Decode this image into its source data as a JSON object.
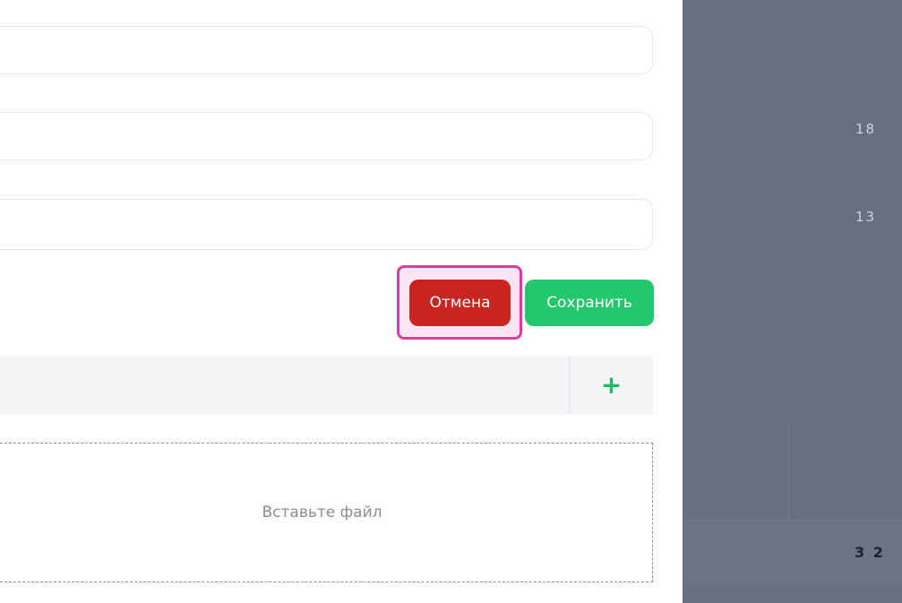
{
  "form": {
    "cancel_label": "Отмена",
    "save_label": "Сохранить",
    "add_symbol": "+",
    "dropzone_text": "Вставьте файл"
  },
  "side": {
    "values": [
      "18",
      "13",
      "3 2"
    ]
  },
  "colors": {
    "cancel": "#c9241f",
    "save": "#22c86b",
    "highlight": "#d63fa8",
    "side_panel": "#667080"
  }
}
